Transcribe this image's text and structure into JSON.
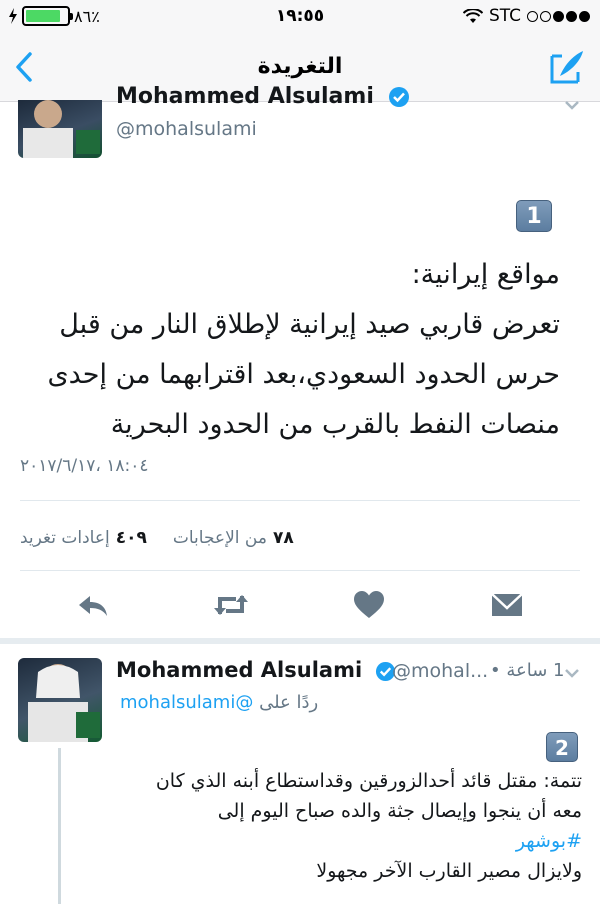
{
  "status_bar": {
    "battery_percent": "٨٦٪",
    "battery_level": 0.86,
    "time": "١٩:٥٥",
    "carrier": "STC"
  },
  "nav": {
    "title": "التغريدة"
  },
  "tweet1": {
    "display_name": "Mohammed Alsulami",
    "handle": "@mohalsulami",
    "number": "1",
    "text_line1": "مواقع إيرانية:",
    "text_line2": "تعرض قاربي صيد إيرانية لإطلاق النار من قبل",
    "text_line3": "حرس الحدود السعودي،بعد اقترابهما من إحدى",
    "text_line4": "منصات النفط بالقرب من الحدود البحرية",
    "datetime": "١٨:٠٤ ،٢٠١٧/٦/١٧",
    "likes_count": "٧٨",
    "likes_label": "من الإعجابات",
    "retweets_count": "٤٠٩",
    "retweets_label": "إعادات تغريد"
  },
  "tweet2": {
    "display_name": "Mohammed Alsulami",
    "handle": "@mohal...",
    "time": "1 ساعة •",
    "reply_prefix": "ردًا على",
    "reply_mention": "@mohalsulami",
    "number": "2",
    "line1": "تتمة: مقتل قائد أحدالزورقين وقداستطاع أبنه الذي كان",
    "line2": "معه أن ينجوا وإيصال جثة والده صباح اليوم إلى",
    "hashtag": "#بوشهر",
    "line3": "ولايزال مصير القارب الآخر مجهولا"
  },
  "colors": {
    "accent": "#1da1f2",
    "muted": "#657786",
    "battery": "#4cd964"
  },
  "icons": [
    "charging-bolt-icon",
    "wifi-icon",
    "back-chevron-icon",
    "compose-icon",
    "verified-badge-icon",
    "chevron-down-icon",
    "reply-icon",
    "retweet-icon",
    "like-heart-icon",
    "direct-message-icon"
  ]
}
